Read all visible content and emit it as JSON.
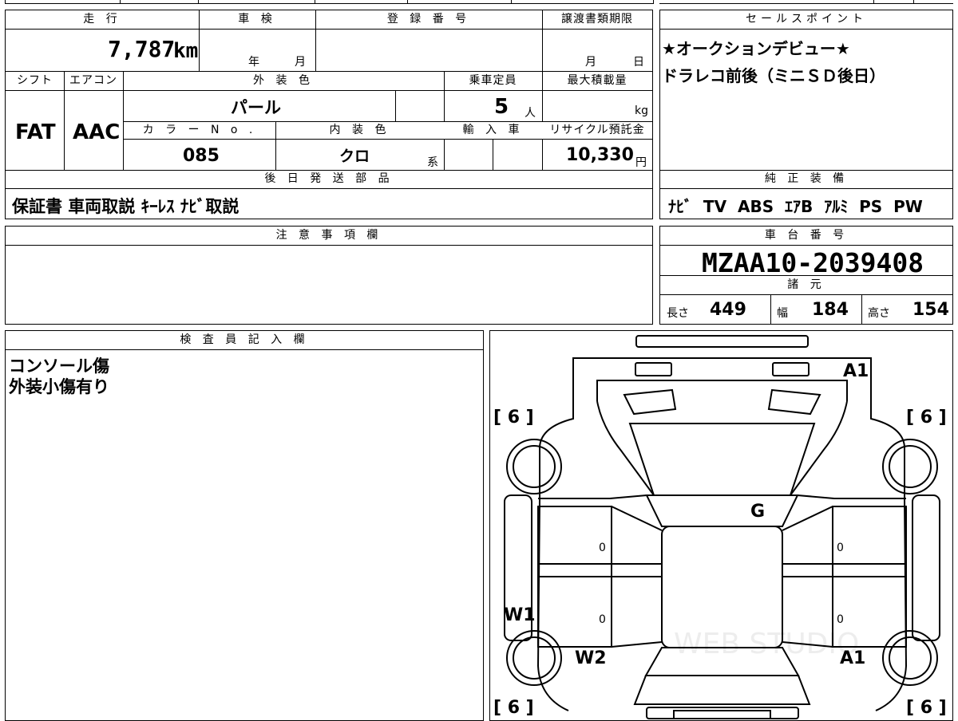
{
  "header": {
    "mileage_label": "走 行",
    "inspection_label": "車 検",
    "registration_label": "登 録 番 号",
    "transfer_label": "譲渡書類期限",
    "mileage_value": "7,787",
    "mileage_unit": "km",
    "year_label": "年",
    "month_label": "月",
    "transfer_month": "月",
    "transfer_day": "日"
  },
  "row2": {
    "shift_label": "シフト",
    "ac_label": "エアコン",
    "exterior_color_label": "外 装 色",
    "capacity_label": "乗車定員",
    "max_load_label": "最大積載量",
    "shift_value": "FAT",
    "ac_value": "AAC",
    "exterior_color_value": "パール",
    "capacity_value": "5",
    "capacity_unit": "人",
    "max_load_unit": "kg",
    "color_no_label": "カ ラ ー N o .",
    "interior_color_label": "内 装 色",
    "import_label": "輸 入 車",
    "recycle_label": "リサイクル預託金",
    "color_no_value": "085",
    "interior_color_value": "クロ",
    "interior_color_suffix": "系",
    "recycle_value": "10,330",
    "recycle_unit": "円"
  },
  "later_parts": {
    "label": "後 日 発 送 部 品",
    "value": "保証書 車両取説 ｷｰﾚｽ ﾅﾋﾞ取説"
  },
  "sales_point": {
    "label": "セールスポイント",
    "lines": [
      "★オークションデビュー★",
      "ドラレコ前後（ミニＳＤ後日）"
    ]
  },
  "genuine_equipment": {
    "label": "純 正 装 備",
    "value": "ﾅﾋﾞ  TV  ABS  ｴｱB  ｱﾙﾐ  PS  PW"
  },
  "notes": {
    "label": "注 意 事 項 欄"
  },
  "chassis": {
    "label": "車 台 番 号",
    "value": "MZAA10-2039408"
  },
  "specs": {
    "label": "諸 元",
    "length_label": "長さ",
    "length_value": "449",
    "width_label": "幅",
    "width_value": "184",
    "height_label": "高さ",
    "height_value": "154"
  },
  "inspector": {
    "label": "検 査 員 記 入 欄",
    "lines": [
      "コンソール傷",
      "外装小傷有り"
    ]
  },
  "diagram": {
    "tire_front_left": "[ 6 ]",
    "tire_front_right": "[ 6 ]",
    "tire_rear_left": "[ 6 ]",
    "tire_rear_right": "[ 6 ]",
    "mark_a1_top": "A1",
    "mark_g": "G",
    "mark_w1": "W1",
    "mark_w2": "W2",
    "mark_a1_bottom": "A1",
    "door_fl": "0",
    "door_rl": "0",
    "door_fr": "0",
    "door_rr": "0",
    "watermark": "WEB STUDIO"
  }
}
